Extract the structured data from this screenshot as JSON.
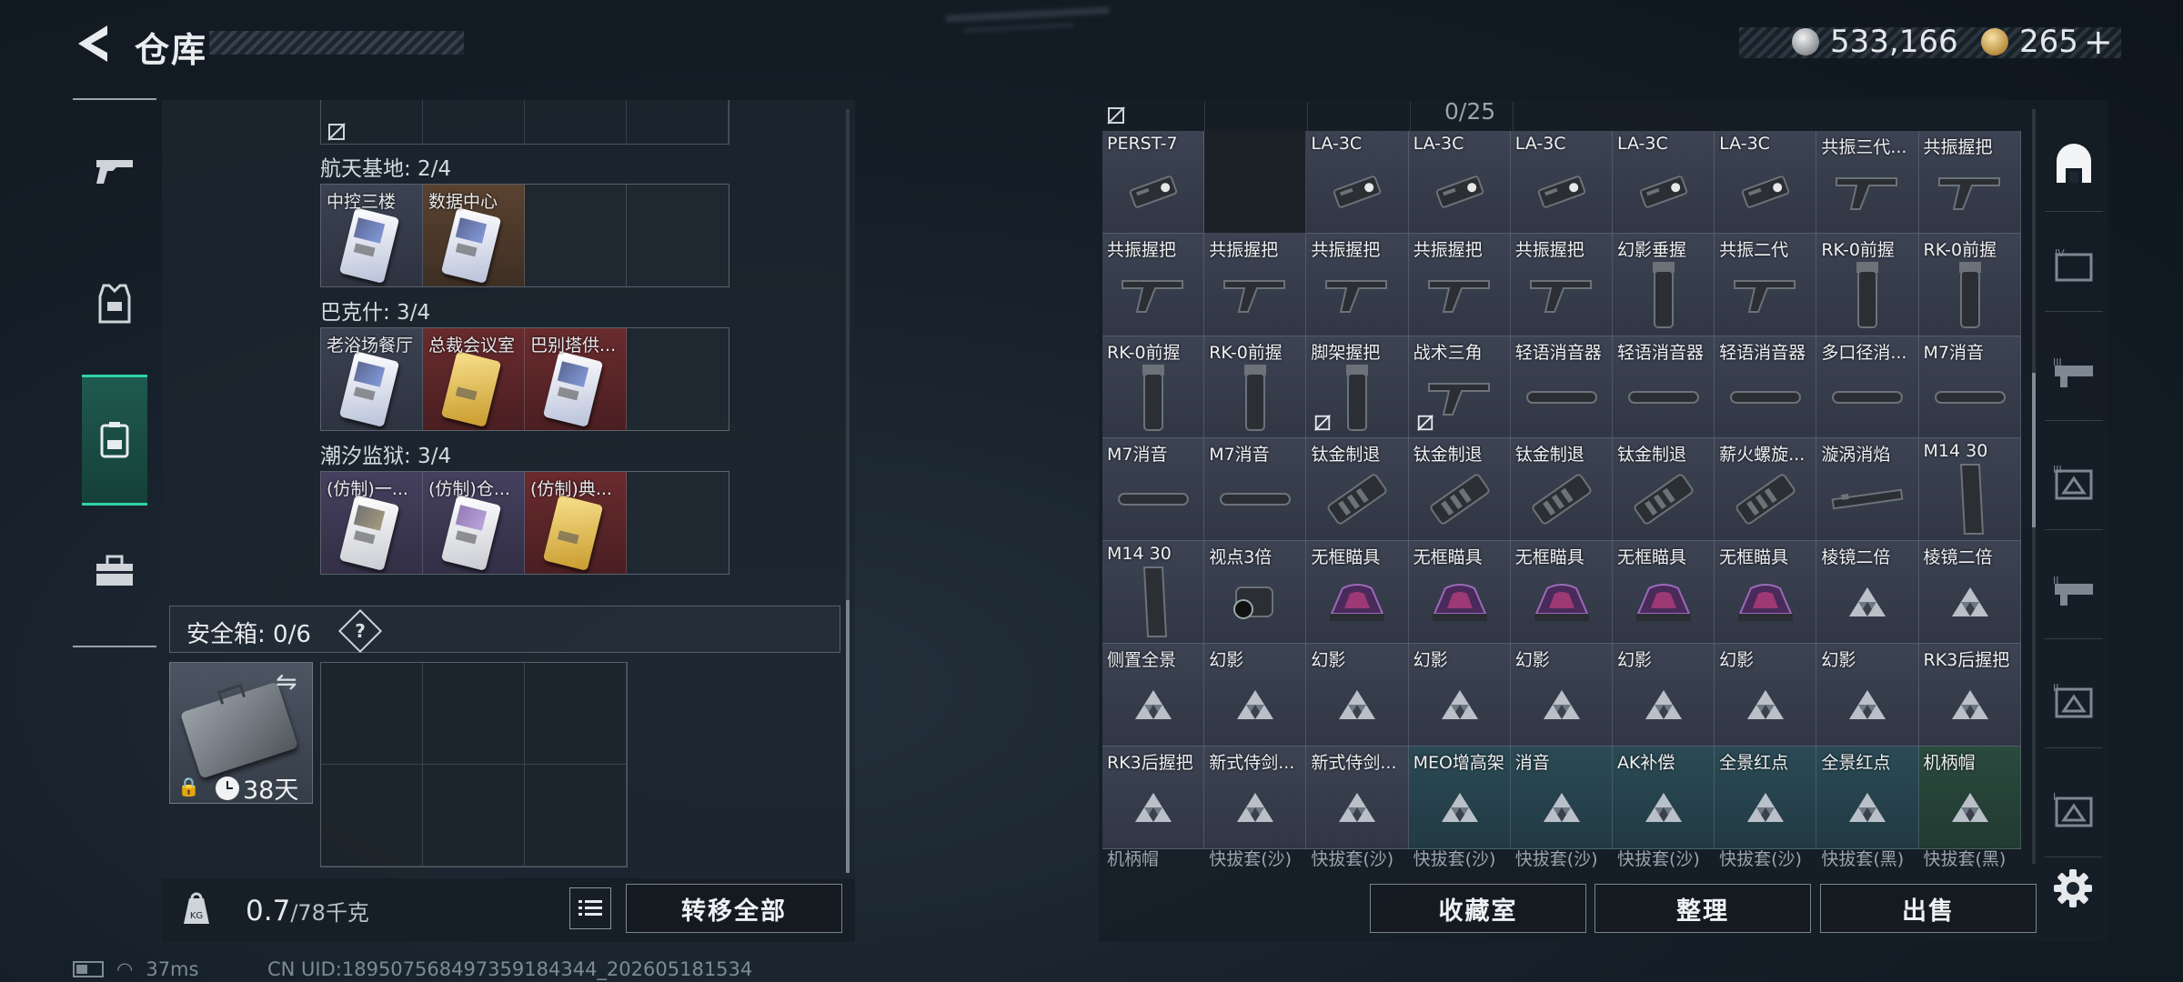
{
  "header": {
    "title": "仓库",
    "silver": "533,166",
    "gold": "265",
    "plus": "+"
  },
  "left_panel": {
    "groups": [
      {
        "label": "航天基地: 2/4",
        "cards": [
          {
            "name": "中控三楼",
            "rarity": "white"
          },
          {
            "name": "数据中心",
            "rarity": "orange"
          }
        ]
      },
      {
        "label": "巴克什: 3/4",
        "cards": [
          {
            "name": "老浴场餐厅",
            "rarity": "white"
          },
          {
            "name": "总裁会议室",
            "rarity": "red"
          },
          {
            "name": "巴别塔供...",
            "rarity": "red"
          }
        ]
      },
      {
        "label": "潮汐监狱: 3/4",
        "cards": [
          {
            "name": "(仿制)一...",
            "rarity": "purple"
          },
          {
            "name": "(仿制)仓...",
            "rarity": "purple"
          },
          {
            "name": "(仿制)典...",
            "rarity": "red"
          }
        ]
      }
    ],
    "safe_box": {
      "label": "安全箱: 0/6",
      "help": "?",
      "days": "38天"
    },
    "bottom": {
      "weight": "0.7",
      "weight_max": "/78千克",
      "transfer_all": "转移全部"
    }
  },
  "right_panel": {
    "count": "0/25",
    "items": [
      {
        "name": "PERST-7",
        "icon": "gadget-icon"
      },
      {
        "name": "",
        "icon": "",
        "empty": true
      },
      {
        "name": "LA-3C",
        "icon": "gadget-icon"
      },
      {
        "name": "LA-3C",
        "icon": "gadget-icon"
      },
      {
        "name": "LA-3C",
        "icon": "gadget-icon"
      },
      {
        "name": "LA-3C",
        "icon": "gadget-icon"
      },
      {
        "name": "LA-3C",
        "icon": "gadget-icon"
      },
      {
        "name": "共振三代...",
        "icon": "grip-icon"
      },
      {
        "name": "共振握把",
        "icon": "grip-icon"
      },
      {
        "name": "共振握把",
        "icon": "grip-icon"
      },
      {
        "name": "共振握把",
        "icon": "grip-icon"
      },
      {
        "name": "共振握把",
        "icon": "grip-icon"
      },
      {
        "name": "共振握把",
        "icon": "grip-icon"
      },
      {
        "name": "共振握把",
        "icon": "grip-icon"
      },
      {
        "name": "幻影垂握",
        "icon": "vgrip-icon"
      },
      {
        "name": "共振二代",
        "icon": "grip-icon"
      },
      {
        "name": "RK-0前握",
        "icon": "vgrip-icon"
      },
      {
        "name": "RK-0前握",
        "icon": "vgrip-icon"
      },
      {
        "name": "RK-0前握",
        "icon": "vgrip-icon"
      },
      {
        "name": "RK-0前握",
        "icon": "vgrip-icon"
      },
      {
        "name": "脚架握把",
        "icon": "vgrip-icon",
        "flag": true
      },
      {
        "name": "战术三角",
        "icon": "grip-icon",
        "flag": true
      },
      {
        "name": "轻语消音器",
        "icon": "suppressor-icon"
      },
      {
        "name": "轻语消音器",
        "icon": "suppressor-icon"
      },
      {
        "name": "轻语消音器",
        "icon": "suppressor-icon"
      },
      {
        "name": "多口径消...",
        "icon": "suppressor-icon"
      },
      {
        "name": "M7消音",
        "icon": "suppressor-icon"
      },
      {
        "name": "M7消音",
        "icon": "suppressor-icon"
      },
      {
        "name": "M7消音",
        "icon": "suppressor-icon"
      },
      {
        "name": "钛金制退",
        "icon": "brake-icon"
      },
      {
        "name": "钛金制退",
        "icon": "brake-icon"
      },
      {
        "name": "钛金制退",
        "icon": "brake-icon"
      },
      {
        "name": "钛金制退",
        "icon": "brake-icon"
      },
      {
        "name": "薪火螺旋...",
        "icon": "brake-icon"
      },
      {
        "name": "漩涡消焰",
        "icon": "handguard-icon"
      },
      {
        "name": "M14 30",
        "icon": "magazine-icon"
      },
      {
        "name": "M14 30",
        "icon": "magazine-icon"
      },
      {
        "name": "视点3倍",
        "icon": "scope-icon"
      },
      {
        "name": "无框瞄具",
        "icon": "redsight-icon"
      },
      {
        "name": "无框瞄具",
        "icon": "redsight-icon"
      },
      {
        "name": "无框瞄具",
        "icon": "redsight-icon"
      },
      {
        "name": "无框瞄具",
        "icon": "redsight-icon"
      },
      {
        "name": "无框瞄具",
        "icon": "redsight-icon"
      },
      {
        "name": "棱镜二倍",
        "icon": "placeholder-icon"
      },
      {
        "name": "棱镜二倍",
        "icon": "placeholder-icon"
      },
      {
        "name": "侧置全景",
        "icon": "placeholder-icon"
      },
      {
        "name": "幻影",
        "icon": "placeholder-icon"
      },
      {
        "name": "幻影",
        "icon": "placeholder-icon"
      },
      {
        "name": "幻影",
        "icon": "placeholder-icon"
      },
      {
        "name": "幻影",
        "icon": "placeholder-icon"
      },
      {
        "name": "幻影",
        "icon": "placeholder-icon"
      },
      {
        "name": "幻影",
        "icon": "placeholder-icon"
      },
      {
        "name": "幻影",
        "icon": "placeholder-icon"
      },
      {
        "name": "RK3后握把",
        "icon": "placeholder-icon"
      },
      {
        "name": "RK3后握把",
        "icon": "placeholder-icon"
      },
      {
        "name": "新式侍剑...",
        "icon": "placeholder-icon"
      },
      {
        "name": "新式侍剑...",
        "icon": "placeholder-icon"
      },
      {
        "name": "MEO增高架",
        "icon": "placeholder-icon",
        "tint": "teal"
      },
      {
        "name": "消音",
        "icon": "placeholder-icon",
        "tint": "teal"
      },
      {
        "name": "AK补偿",
        "icon": "placeholder-icon",
        "tint": "teal"
      },
      {
        "name": "全景红点",
        "icon": "placeholder-icon",
        "tint": "teal"
      },
      {
        "name": "全景红点",
        "icon": "placeholder-icon",
        "tint": "teal"
      },
      {
        "name": "机柄帽",
        "icon": "placeholder-icon",
        "tint": "green"
      }
    ],
    "partial_row": [
      "机柄帽",
      "快拔套(沙)",
      "快拔套(沙)",
      "快拔套(沙)",
      "快拔套(沙)",
      "快拔套(沙)",
      "快拔套(沙)",
      "快拔套(黑)",
      "快拔套(黑)"
    ],
    "buttons": {
      "collection": "收藏室",
      "sort": "整理",
      "sell": "出售"
    }
  },
  "status": {
    "ping": "37ms",
    "uid": "CN UID:18950756849735918434​4_202605181534"
  }
}
